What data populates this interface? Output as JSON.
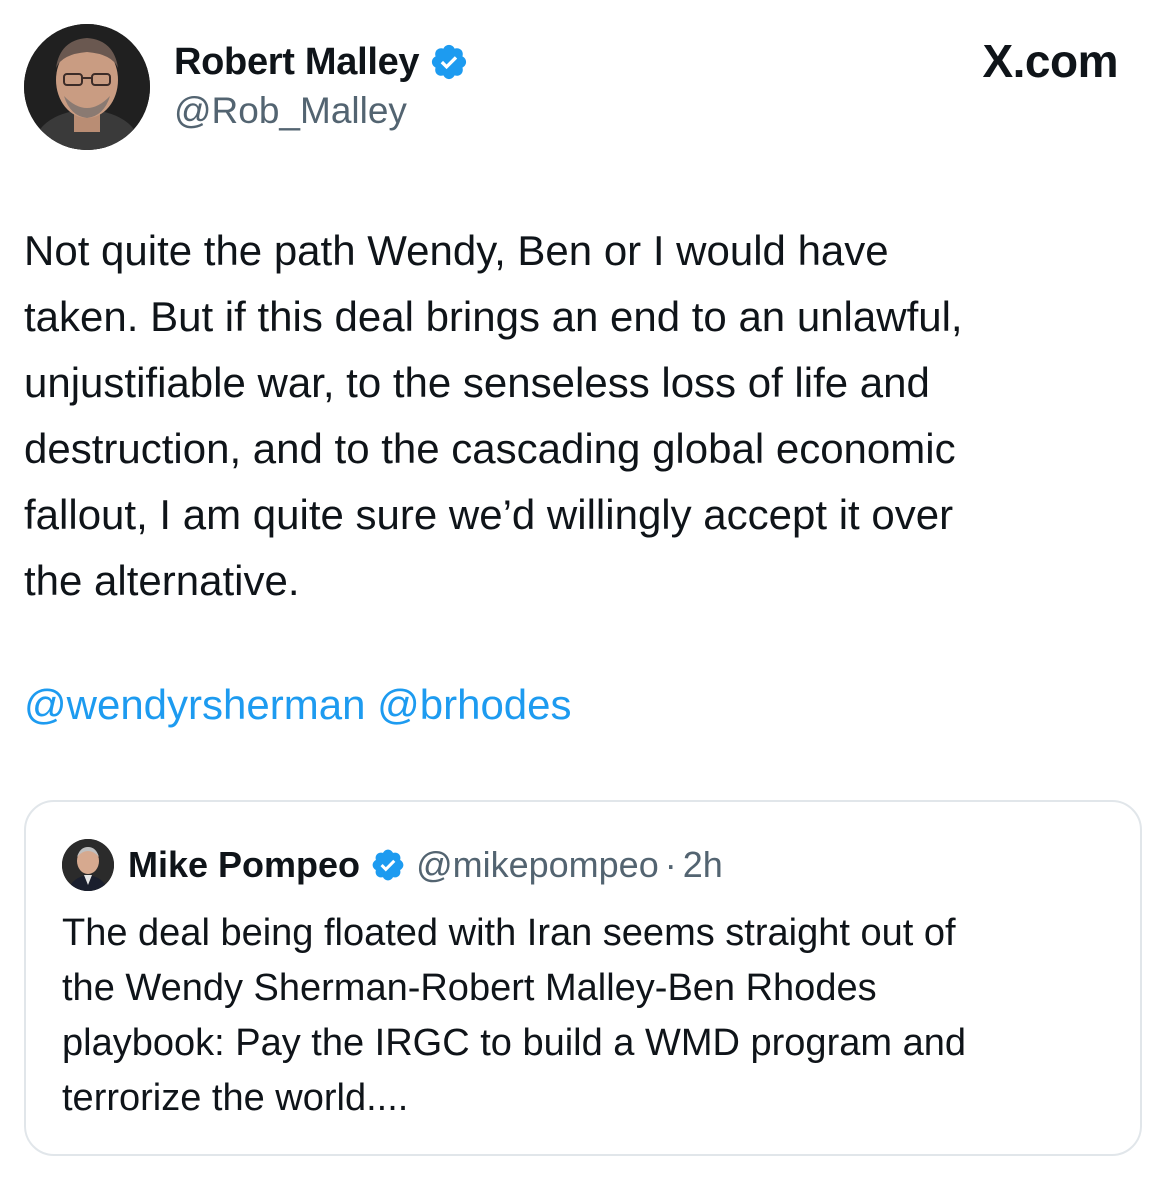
{
  "brand": {
    "logo_text": "X.com"
  },
  "author": {
    "name": "Robert Malley",
    "handle": "@Rob_Malley",
    "verified_color": "#1d9bf0",
    "avatar_icon": "portrait-avatar"
  },
  "tweet": {
    "text": "Not quite the path Wendy, Ben or I would have\ntaken. But if this deal brings an end to an unlawful,\nunjustifiable war, to the senseless loss of life and\ndestruction, and to the cascading global economic\nfallout, I am quite sure we’d willingly accept it over\nthe alternative.",
    "mentions": [
      "@wendyrsherman",
      "@brhodes"
    ],
    "link_color": "#1d9bf0"
  },
  "quoted_tweet": {
    "name": "Mike Pompeo",
    "handle": "@mikepompeo",
    "separator": "·",
    "time": "2h",
    "avatar_icon": "portrait-avatar",
    "text": "The deal being floated with Iran seems straight out of\nthe Wendy Sherman-Robert Malley-Ben Rhodes\nplaybook: Pay the IRGC to build a WMD program and\nterrorize the world...."
  }
}
